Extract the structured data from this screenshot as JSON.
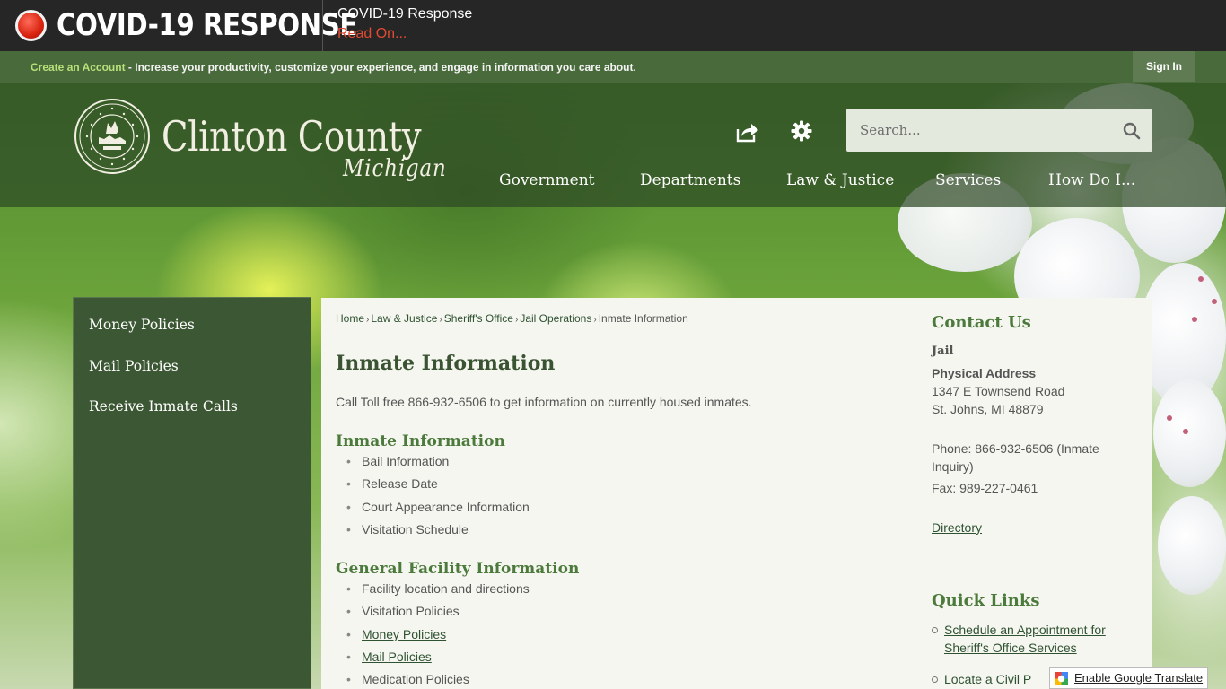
{
  "covid": {
    "title": "COVID-19 RESPONSE",
    "sub_title": "COVID-19 Response",
    "read_on": "Read On..."
  },
  "account_bar": {
    "create_link": "Create an Account",
    "message": " - Increase your productivity, customize your experience, and engage in information you care about.",
    "sign_in": "Sign In"
  },
  "header": {
    "logo_name": "Clinton County",
    "logo_state": "Michigan",
    "search_placeholder": "Search...",
    "nav": [
      "Government",
      "Departments",
      "Law & Justice",
      "Services",
      "How Do I..."
    ]
  },
  "sidebar": {
    "items": [
      "Money Policies",
      "Mail Policies",
      "Receive Inmate Calls"
    ]
  },
  "breadcrumb": {
    "items": [
      "Home",
      "Law & Justice",
      "Sheriff's Office",
      "Jail Operations"
    ],
    "current": "Inmate Information"
  },
  "page": {
    "title": "Inmate Information",
    "intro": "Call Toll free 866-932-6506 to get information on currently housed inmates.",
    "section1_title": "Inmate Information",
    "section1_items": [
      "Bail Information",
      "Release Date",
      "Court Appearance Information",
      "Visitation Schedule"
    ],
    "section2_title": "General Facility Information",
    "section2_items": [
      "Facility location and directions",
      "Visitation Policies",
      "Money Policies",
      "Mail Policies",
      "Medication Policies"
    ]
  },
  "contact": {
    "title": "Contact Us",
    "name": "Jail",
    "address_label": "Physical Address",
    "address_line1": "1347 E Townsend Road",
    "address_line2": "St. Johns, MI 48879",
    "phone": "Phone: 866-932-6506 (Inmate Inquiry)",
    "fax": "Fax: 989-227-0461",
    "directory": "Directory"
  },
  "quick_links": {
    "title": "Quick Links",
    "items": [
      "Schedule an Appointment for Sheriff's Office Services",
      "Locate a Civil P"
    ]
  },
  "translate": {
    "label": "Enable Google Translate"
  },
  "colors": {
    "header_green": "#496a3a",
    "sidebar_green": "#3c5733",
    "heading_green": "#4c7a3c",
    "covid_red": "#e04a32"
  }
}
